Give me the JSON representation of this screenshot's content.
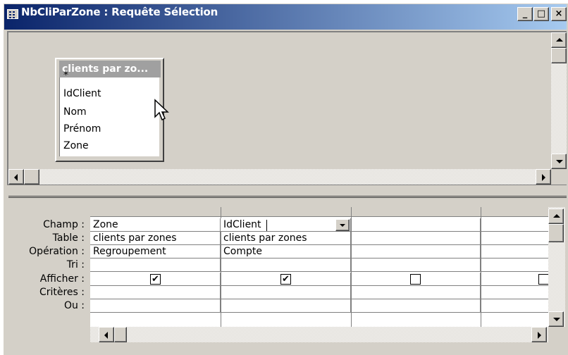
{
  "window": {
    "title": "NbCliParZone : Requête Sélection",
    "caption_buttons": {
      "minimize": "_",
      "maximize": "□",
      "close": "×"
    }
  },
  "field_list": {
    "title": "clients par zo...",
    "items": [
      "*",
      "IdClient",
      "Nom",
      "Prénom",
      "Zone"
    ]
  },
  "grid": {
    "row_labels": [
      "Champ :",
      "Table :",
      "Opération :",
      "Tri :",
      "Afficher :",
      "Critères :",
      "Ou :"
    ],
    "columns": [
      {
        "champ": "Zone",
        "table": "clients par zones",
        "operation": "Regroupement",
        "afficher": true
      },
      {
        "champ": "IdClient",
        "table": "clients par zones",
        "operation": "Compte",
        "afficher": true
      },
      {
        "champ": "",
        "table": "",
        "operation": "",
        "afficher": false
      },
      {
        "champ": "",
        "table": "",
        "operation": "",
        "afficher": false
      }
    ]
  },
  "colors": {
    "title_start": "#0a246a",
    "title_end": "#a6caf0",
    "face": "#d4d0c8"
  }
}
